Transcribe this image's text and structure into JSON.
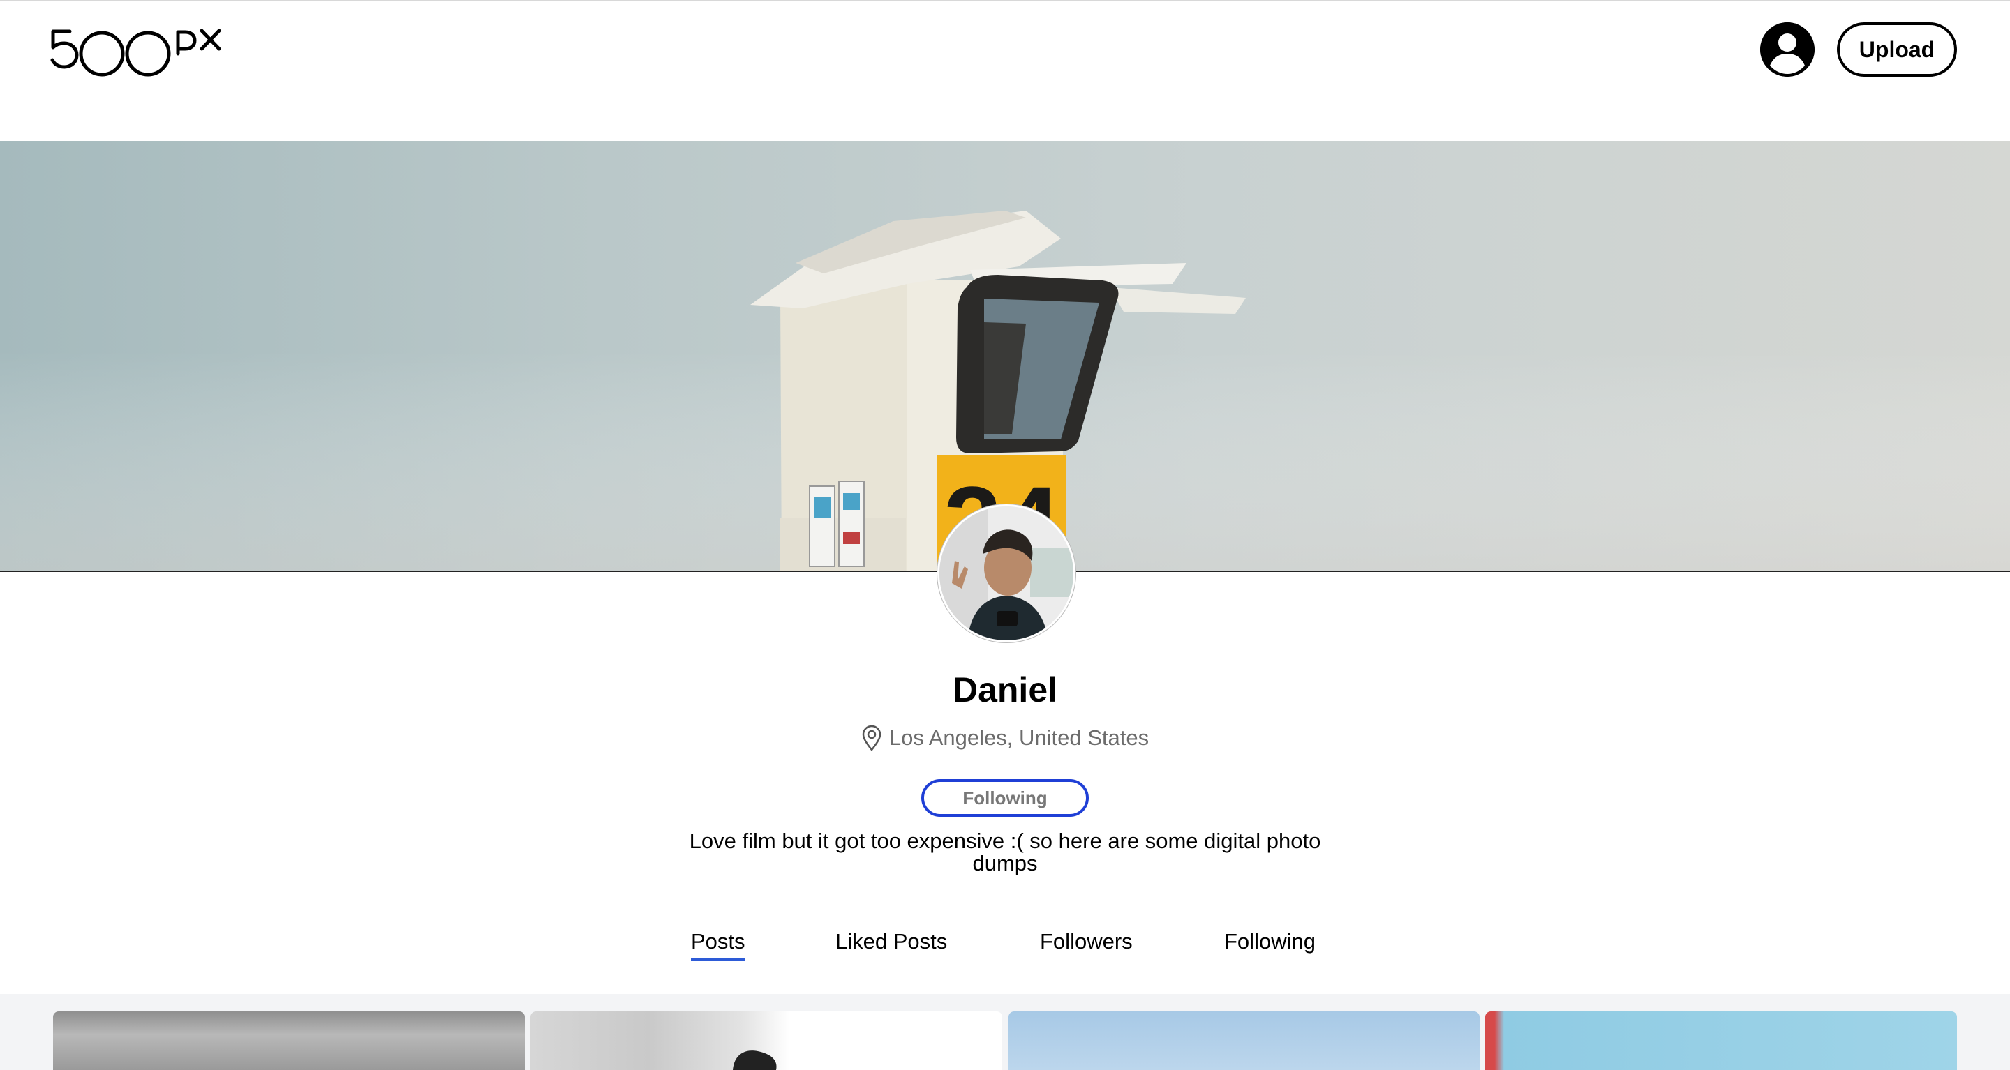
{
  "header": {
    "logo_text": "500px",
    "user_avatar_icon": "user-circle-icon",
    "upload_label": "Upload"
  },
  "profile": {
    "name": "Daniel",
    "location_icon": "map-pin-icon",
    "location": "Los Angeles, United States",
    "follow_status_label": "Following",
    "bio": "Love film but it got too expensive :( so here are some digital photo dumps"
  },
  "tabs": [
    {
      "label": "Posts",
      "active": true
    },
    {
      "label": "Liked Posts",
      "active": false
    },
    {
      "label": "Followers",
      "active": false
    },
    {
      "label": "Following",
      "active": false
    }
  ],
  "colors": {
    "accent": "#1f3fd6",
    "tab_underline": "#2d5bd7",
    "grid_background": "#f3f4f6"
  }
}
